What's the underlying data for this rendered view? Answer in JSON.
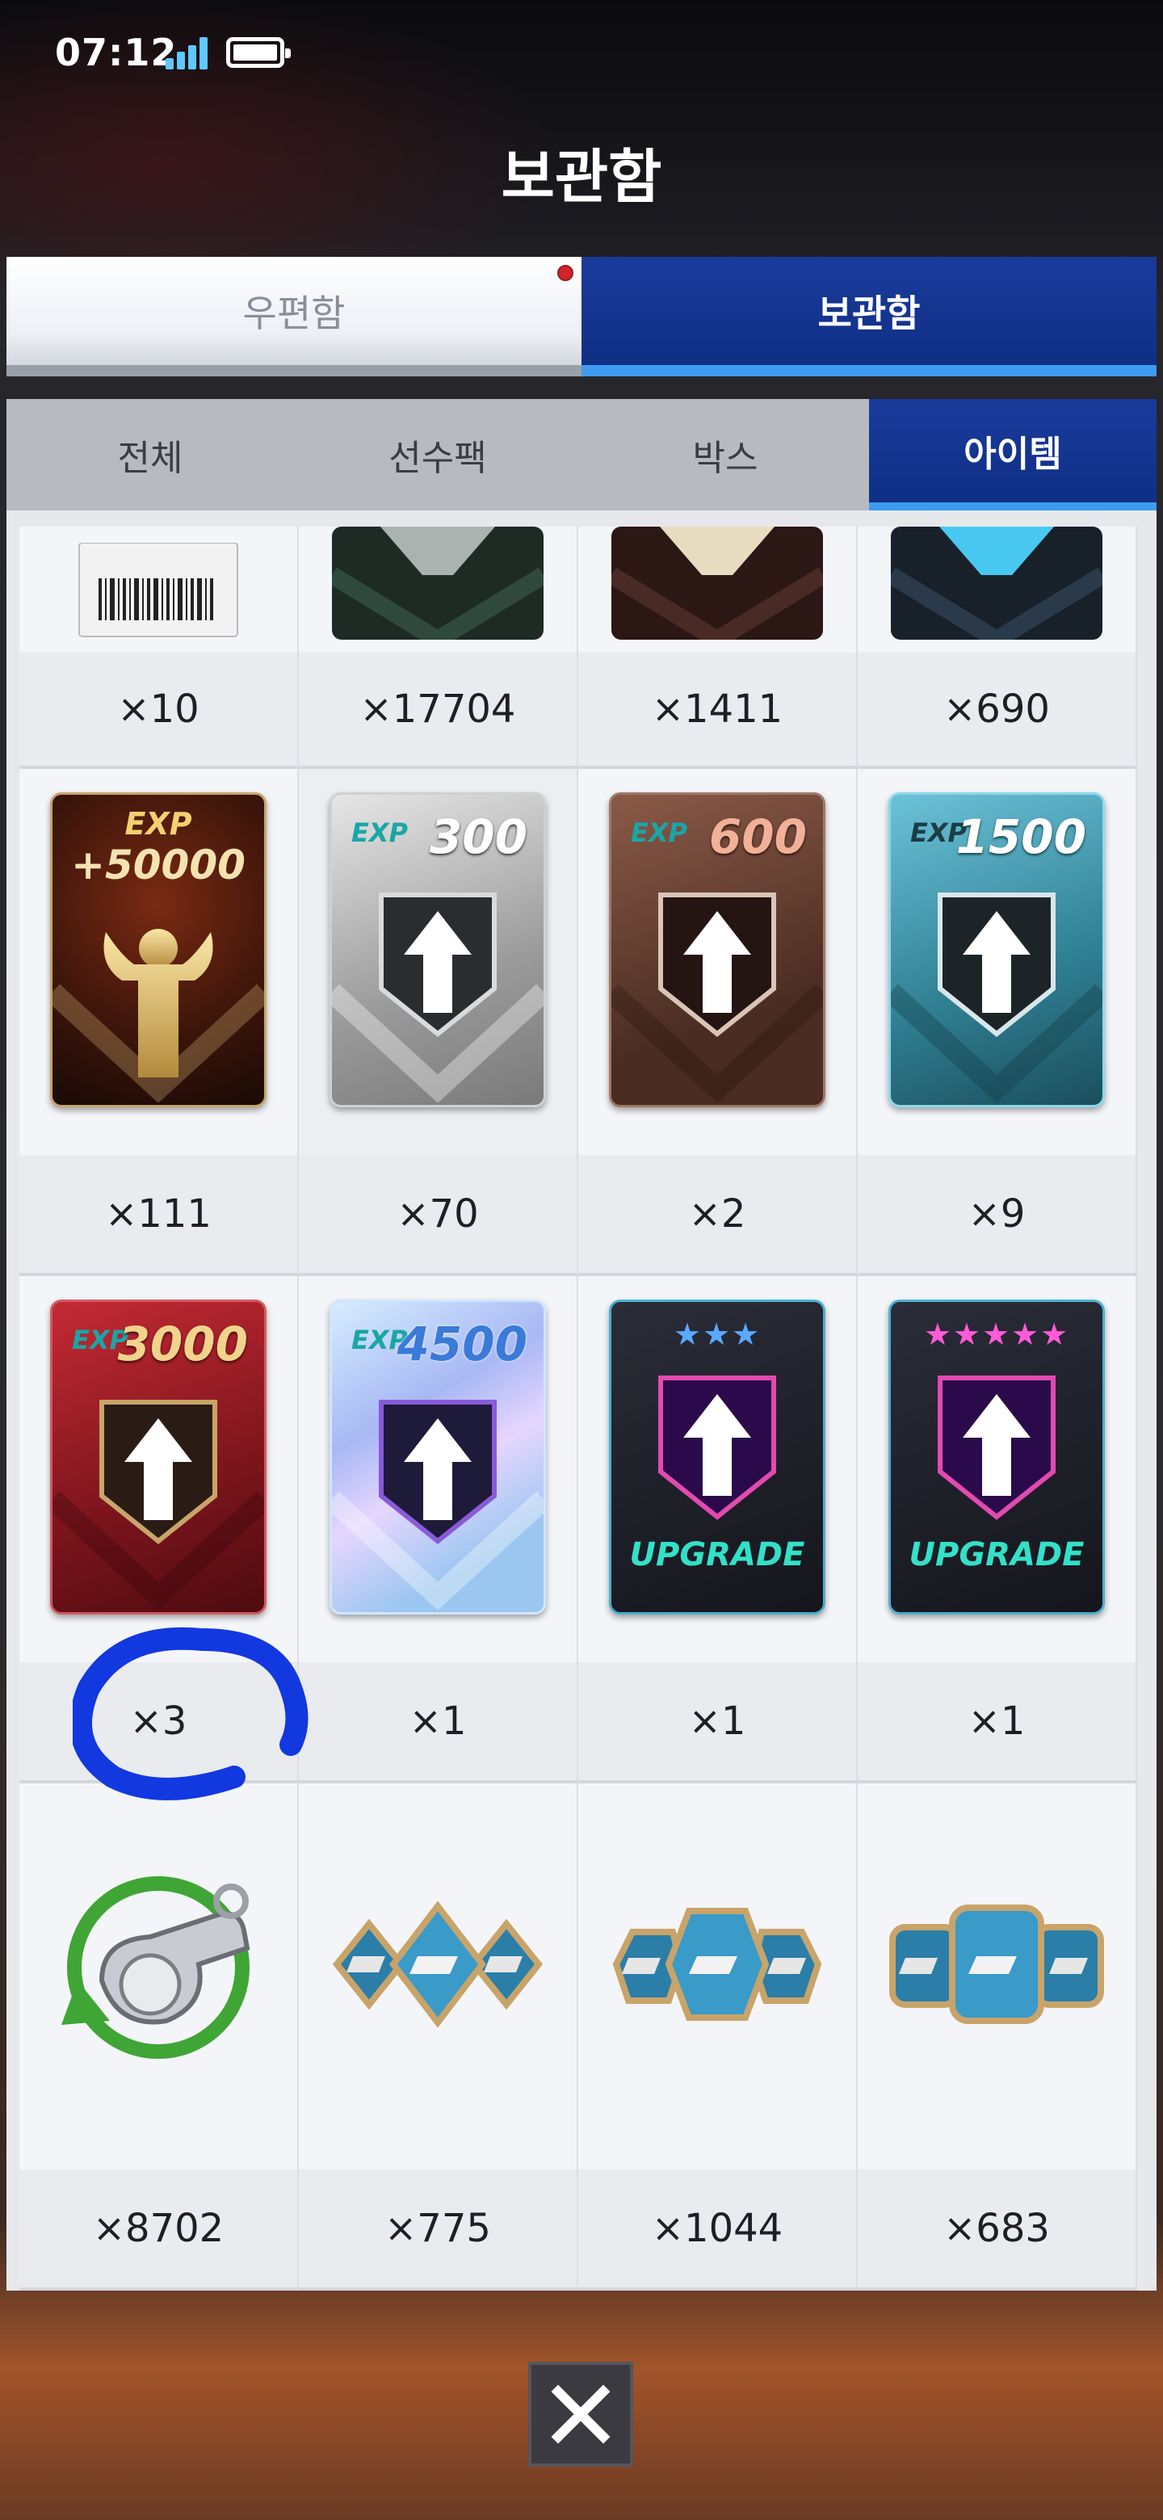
{
  "status_bar": {
    "time": "07:12"
  },
  "header": {
    "title": "보관함"
  },
  "top_tabs": [
    {
      "label": "우편함",
      "active": false,
      "notification": true
    },
    {
      "label": "보관함",
      "active": true,
      "notification": false
    }
  ],
  "sub_tabs": [
    {
      "label": "전체",
      "active": false
    },
    {
      "label": "선수팩",
      "active": false
    },
    {
      "label": "박스",
      "active": false
    },
    {
      "label": "아이템",
      "active": true
    }
  ],
  "items": [
    {
      "icon": "coupon-ticket-icon",
      "count": "×10"
    },
    {
      "icon": "dark-green-card-icon",
      "count": "×17704"
    },
    {
      "icon": "dark-brown-card-icon",
      "count": "×1411"
    },
    {
      "icon": "dark-blue-card-icon",
      "count": "×690"
    },
    {
      "icon": "exp-50000-card-icon",
      "exp_label": "EXP",
      "exp_value": "+50000",
      "count": "×111"
    },
    {
      "icon": "exp-300-card-icon",
      "exp_label": "EXP",
      "exp_value": "300",
      "count": "×70"
    },
    {
      "icon": "exp-600-card-icon",
      "exp_label": "EXP",
      "exp_value": "600",
      "count": "×2"
    },
    {
      "icon": "exp-1500-card-icon",
      "exp_label": "EXP",
      "exp_value": "1500",
      "count": "×9"
    },
    {
      "icon": "exp-3000-card-icon",
      "exp_label": "EXP",
      "exp_value": "3000",
      "count": "×3"
    },
    {
      "icon": "exp-4500-card-icon",
      "exp_label": "EXP",
      "exp_value": "4500",
      "count": "×1"
    },
    {
      "icon": "upgrade-3-star-card-icon",
      "stars": "★★★",
      "upgrade_label": "UPGRADE",
      "count": "×1"
    },
    {
      "icon": "upgrade-5-star-card-icon",
      "stars": "★★★★★",
      "upgrade_label": "UPGRADE",
      "count": "×1"
    },
    {
      "icon": "whistle-icon",
      "count": "×8702"
    },
    {
      "icon": "small-gem-tokens-icon",
      "count": "×775"
    },
    {
      "icon": "medium-gem-tokens-icon",
      "count": "×1044"
    },
    {
      "icon": "large-gem-tokens-icon",
      "count": "×683"
    }
  ],
  "colors": {
    "accent_blue": "#0f2f85",
    "tab_underline": "#3d9bf0",
    "annotation": "#1238e0"
  }
}
